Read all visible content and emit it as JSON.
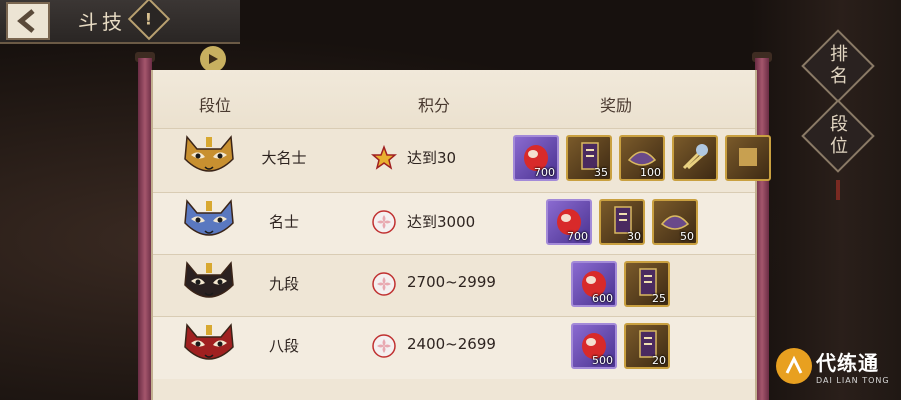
{
  "topbar": {
    "title": "斗技"
  },
  "panel": {
    "headers": {
      "rank": "段位",
      "score": "积分",
      "reward": "奖励"
    },
    "rows": [
      {
        "rank": "大名士",
        "score": "达到30",
        "score_icon": "star-badge-icon",
        "mask_color": "#c89030",
        "rewards": [
          {
            "icon": "red-daruma-icon",
            "count": "700",
            "style": "purple"
          },
          {
            "icon": "banner-ticket-icon",
            "count": "35",
            "style": "gold"
          },
          {
            "icon": "purple-charm-icon",
            "count": "100",
            "style": "gold"
          },
          {
            "icon": "fan-icon",
            "count": "",
            "style": "gold"
          },
          {
            "icon": "partial-item-icon",
            "count": "",
            "style": "gold"
          }
        ]
      },
      {
        "rank": "名士",
        "score": "达到3000",
        "score_icon": "sakura-badge-icon",
        "mask_color": "#5a78c0",
        "rewards": [
          {
            "icon": "red-daruma-icon",
            "count": "700",
            "style": "purple"
          },
          {
            "icon": "banner-ticket-icon",
            "count": "30",
            "style": "gold"
          },
          {
            "icon": "purple-charm-icon",
            "count": "50",
            "style": "gold"
          }
        ]
      },
      {
        "rank": "九段",
        "score": "2700~2999",
        "score_icon": "sakura-badge-icon",
        "mask_color": "#2a2020",
        "rewards": [
          {
            "icon": "red-daruma-icon",
            "count": "600",
            "style": "purple"
          },
          {
            "icon": "banner-ticket-icon",
            "count": "25",
            "style": "gold"
          }
        ]
      },
      {
        "rank": "八段",
        "score": "2400~2699",
        "score_icon": "sakura-badge-icon",
        "mask_color": "#a02020",
        "rewards": [
          {
            "icon": "red-daruma-icon",
            "count": "500",
            "style": "purple"
          },
          {
            "icon": "banner-ticket-icon",
            "count": "20",
            "style": "gold"
          }
        ]
      }
    ]
  },
  "side": {
    "ranking": "排名",
    "tier": "段位"
  },
  "watermark": {
    "main": "代练通",
    "sub": "DAI LIAN TONG"
  }
}
